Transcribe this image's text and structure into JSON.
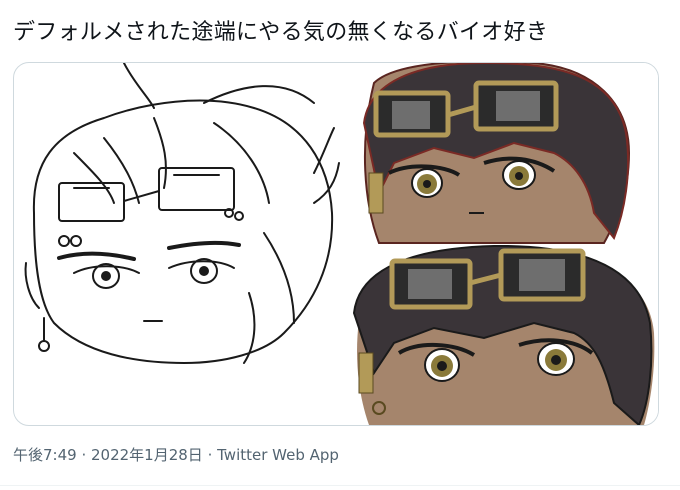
{
  "tweet": {
    "text": "デフォルメされた途端にやる気の無くなるバイオ好き"
  },
  "meta": {
    "time": "午後7:49",
    "separator1": " · ",
    "date": "2022年1月28日",
    "separator2": " · ",
    "source": "Twitter Web App"
  },
  "colors": {
    "text_primary": "#0f1419",
    "text_secondary": "#536471",
    "border": "#cfd9de",
    "skin": "#a5856c",
    "hair": "#3a3438",
    "goggle_frame": "#b29a58"
  },
  "media": {
    "panels": [
      "sketch-drawing",
      "colored-drawing-top",
      "colored-drawing-bottom"
    ]
  }
}
